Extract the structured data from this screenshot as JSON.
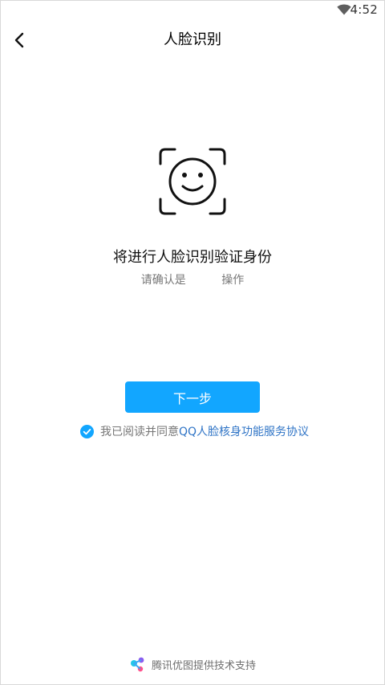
{
  "status_bar": {
    "time": "4:52",
    "icons": [
      "wifi-icon"
    ]
  },
  "nav": {
    "back_icon": "chevron-left-icon",
    "title": "人脸识别"
  },
  "content": {
    "face_icon": "face-scan-icon",
    "heading": "将进行人脸识别验证身份",
    "subtext": "请确认是          操作"
  },
  "actions": {
    "next_label": "下一步"
  },
  "agreement": {
    "checked": true,
    "prefix": "我已阅读并同意",
    "link": "QQ人脸核身功能服务协议"
  },
  "footer": {
    "text": "腾讯优图提供技术支持"
  },
  "colors": {
    "accent": "#12a6ff",
    "link": "#2f74c6",
    "muted_text": "#777777"
  }
}
